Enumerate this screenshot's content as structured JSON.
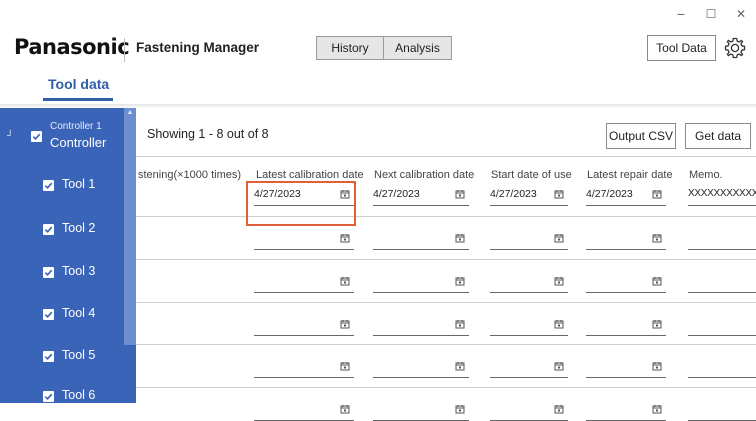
{
  "window": {
    "minimize_glyph": "−",
    "maximize_glyph": "☐",
    "close_glyph": "✕"
  },
  "header": {
    "logo": "Panasonic",
    "app_title": "Fastening Manager",
    "segments": [
      {
        "label": "History"
      },
      {
        "label": "Analysis"
      }
    ],
    "tool_data_button": "Tool Data",
    "settings_icon": "gear-icon"
  },
  "tabs": {
    "active": "Tool data"
  },
  "sidebar": {
    "controller": {
      "line1": "Controller 1",
      "line2": "Controller",
      "checked": true
    },
    "items": [
      {
        "label": "Tool 1",
        "checked": true
      },
      {
        "label": "Tool 2",
        "checked": true
      },
      {
        "label": "Tool 3",
        "checked": true
      },
      {
        "label": "Tool 4",
        "checked": true
      },
      {
        "label": "Tool 5",
        "checked": true
      },
      {
        "label": "Tool 6",
        "checked": true
      }
    ]
  },
  "toolbar": {
    "showing": "Showing 1 - 8 out of 8",
    "output_csv": "Output CSV",
    "get_data": "Get data"
  },
  "table": {
    "columns": [
      "stening(×1000 times)",
      "Latest calibration date",
      "Next calibration date",
      "Start date of use",
      "Latest repair date",
      "Memo."
    ],
    "rows": [
      {
        "latest_calibration": "4/27/2023",
        "next_calibration": "4/27/2023",
        "start_date": "4/27/2023",
        "latest_repair": "4/27/2023",
        "memo": "XXXXXXXXXXX"
      },
      {
        "latest_calibration": "",
        "next_calibration": "",
        "start_date": "",
        "latest_repair": "",
        "memo": ""
      },
      {
        "latest_calibration": "",
        "next_calibration": "",
        "start_date": "",
        "latest_repair": "",
        "memo": ""
      },
      {
        "latest_calibration": "",
        "next_calibration": "",
        "start_date": "",
        "latest_repair": "",
        "memo": ""
      },
      {
        "latest_calibration": "",
        "next_calibration": "",
        "start_date": "",
        "latest_repair": "",
        "memo": ""
      },
      {
        "latest_calibration": "",
        "next_calibration": "",
        "start_date": "",
        "latest_repair": "",
        "memo": ""
      }
    ]
  },
  "colors": {
    "accent": "#2f5fa8",
    "sidebar": "#3a64b8",
    "highlight": "#e0603a"
  }
}
